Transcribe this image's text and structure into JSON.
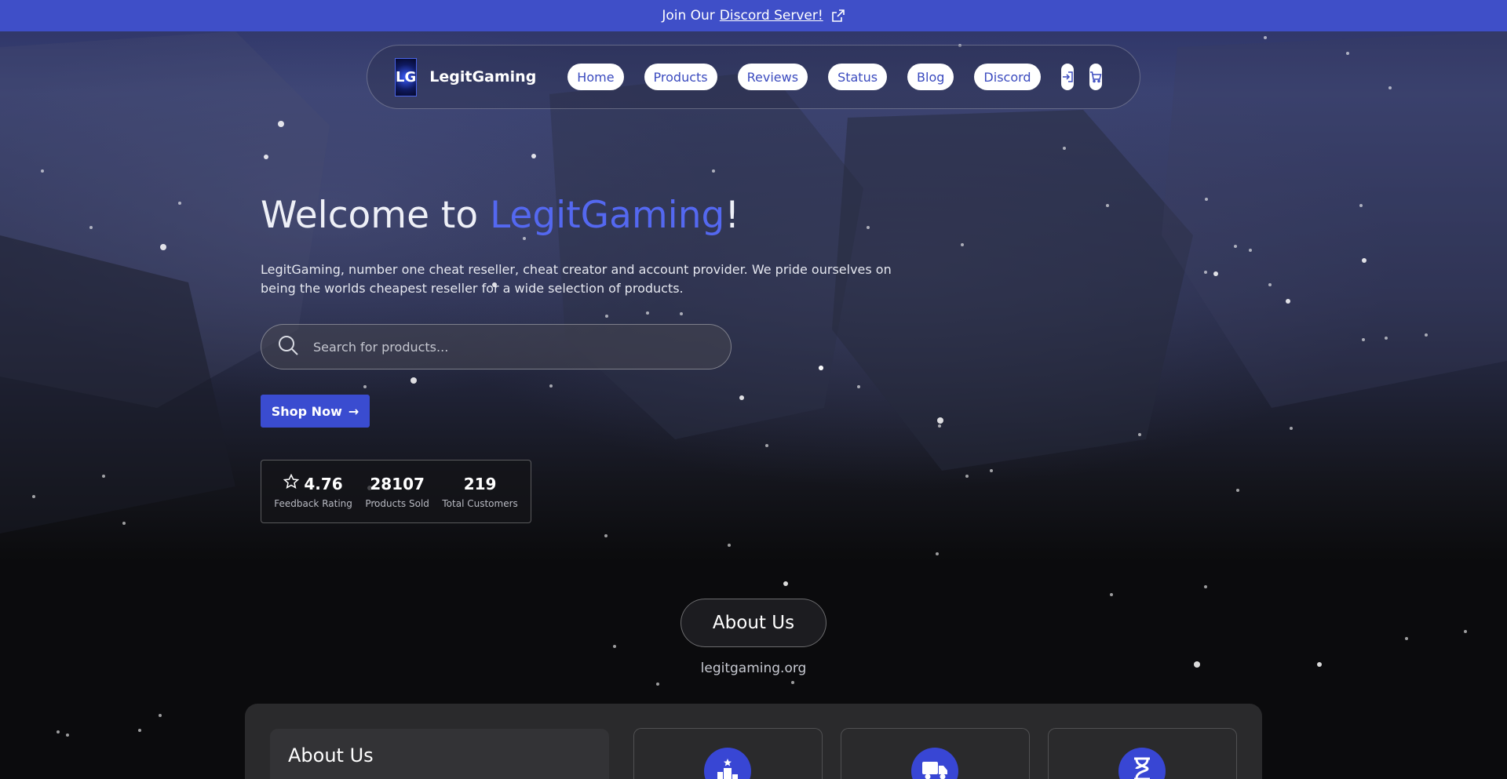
{
  "announcement": {
    "prefix": " Join Our",
    "link_text": "Discord Server!",
    "external_icon": "external-link-icon"
  },
  "nav": {
    "logo_text": "LG",
    "brand": "LegitGaming",
    "links": [
      "Home",
      "Products",
      "Reviews",
      "Status",
      "Blog",
      "Discord"
    ],
    "login_icon": "login-icon",
    "cart_icon": "cart-icon"
  },
  "hero": {
    "title_prefix": "Welcome to ",
    "title_accent": "LegitGaming",
    "title_suffix": "!",
    "description": "LegitGaming, number one cheat reseller, cheat creator and account provider. We pride ourselves on being the worlds cheapest reseller for a wide selection of products.",
    "search_placeholder": "Search for products...",
    "shop_button": "Shop Now",
    "shop_arrow": "→"
  },
  "stats": [
    {
      "value": "4.76",
      "label": "Feedback Rating",
      "icon": "star-icon"
    },
    {
      "value": "28107",
      "label": "Products Sold"
    },
    {
      "value": "219",
      "label": "Total Customers"
    }
  ],
  "about": {
    "pill_label": "About Us ",
    "domain": "legitgaming.org",
    "card_title": "About Us",
    "feature_icons": [
      "podium-icon",
      "truck-icon",
      "hourglass-icon"
    ]
  },
  "colors": {
    "accent": "#3f4fc8",
    "title_accent": "#5468f0",
    "nav_text": "#3b4bbf"
  }
}
